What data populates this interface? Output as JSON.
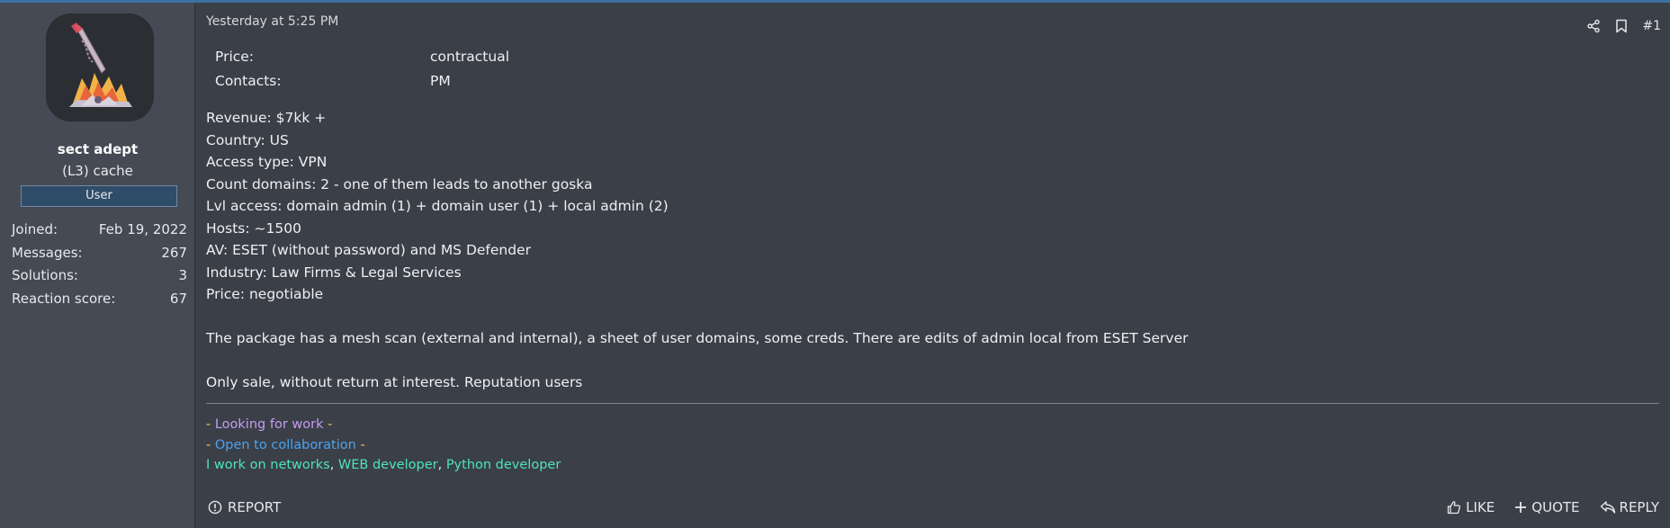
{
  "user": {
    "name": "sect adept",
    "title": "(L3) cache",
    "banner": "User",
    "stats": [
      {
        "label": "Joined:",
        "value": "Feb 19, 2022"
      },
      {
        "label": "Messages:",
        "value": "267"
      },
      {
        "label": "Solutions:",
        "value": "3"
      },
      {
        "label": "Reaction score:",
        "value": "67"
      }
    ]
  },
  "post": {
    "timestamp": "Yesterday at 5:25 PM",
    "number": "#1",
    "fields": [
      {
        "key": "Price:",
        "value": "contractual"
      },
      {
        "key": "Contacts:",
        "value": "PM"
      }
    ],
    "lines": [
      "Revenue: $7kk +",
      "Country: US",
      "Access type: VPN",
      "Count domains: 2 - one of them leads to another goska",
      "Lvl access: domain admin (1) + domain user (1) + local admin (2)",
      "Hosts: ~1500",
      "AV: ESET (without password) and MS Defender",
      "Industry: Law Firms & Legal Services",
      "Price: negotiable"
    ],
    "paragraph1": "The package has a mesh scan (external and internal), a sheet of user domains, some creds. There are edits of admin local from ESET Server",
    "paragraph2": "Only sale, without return at interest. Reputation users"
  },
  "signature": {
    "line1_prefix": "- ",
    "line1_text": "Looking for work",
    "line1_suffix": " -",
    "line2_prefix": "- ",
    "line2_text": "Open to collaboration",
    "line2_suffix": " -",
    "line3_a": "I work on networks",
    "line3_sep1": ", ",
    "line3_b": "WEB developer",
    "line3_sep2": ", ",
    "line3_c": "Python developer"
  },
  "footer": {
    "report": "REPORT",
    "like": "LIKE",
    "quote": "QUOTE",
    "reply": "REPLY"
  },
  "colors": {
    "user_cell_bg": "#454a54",
    "message_bg": "#3b3f47",
    "sig_yellow": "#e3d35a",
    "sig_purple": "#c79cf2",
    "sig_blue": "#4aa3f0",
    "sig_teal": "#4ee3c1"
  }
}
